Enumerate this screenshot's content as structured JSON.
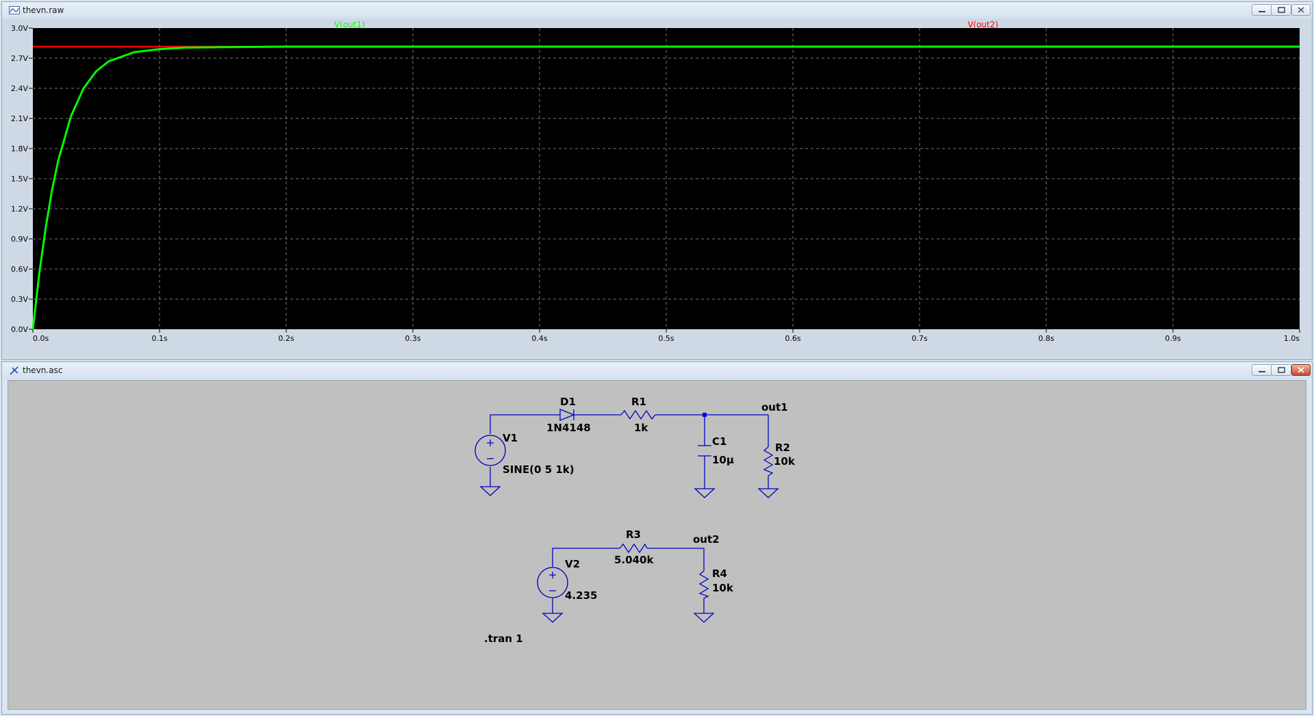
{
  "waveform_window": {
    "title": "thevn.raw",
    "traces": [
      {
        "name": "V(out1)",
        "color": "#00ff00"
      },
      {
        "name": "V(out2)",
        "color": "#ff0000"
      }
    ]
  },
  "schematic_window": {
    "title": "thevn.asc",
    "components": {
      "D1": {
        "ref": "D1",
        "value": "1N4148"
      },
      "R1": {
        "ref": "R1",
        "value": "1k"
      },
      "C1": {
        "ref": "C1",
        "value": "10µ"
      },
      "R2": {
        "ref": "R2",
        "value": "10k"
      },
      "V1": {
        "ref": "V1",
        "value": "SINE(0 5 1k)"
      },
      "R3": {
        "ref": "R3",
        "value": "5.040k"
      },
      "R4": {
        "ref": "R4",
        "value": "10k"
      },
      "V2": {
        "ref": "V2",
        "value": "4.235"
      }
    },
    "net_labels": {
      "out1": "out1",
      "out2": "out2"
    },
    "directive": ".tran 1"
  },
  "chart_data": {
    "type": "line",
    "xlabel": "",
    "ylabel": "",
    "xlim": [
      0,
      1.0
    ],
    "ylim": [
      0,
      3.0
    ],
    "x_tick_labels": [
      "0.0s",
      "0.1s",
      "0.2s",
      "0.3s",
      "0.4s",
      "0.5s",
      "0.6s",
      "0.7s",
      "0.8s",
      "0.9s",
      "1.0s"
    ],
    "y_tick_labels": [
      "0.0V",
      "0.3V",
      "0.6V",
      "0.9V",
      "1.2V",
      "1.5V",
      "1.8V",
      "2.1V",
      "2.4V",
      "2.7V",
      "3.0V"
    ],
    "grid": true,
    "series": [
      {
        "name": "V(out1)",
        "color": "#00ff00",
        "x": [
          0,
          0.005,
          0.01,
          0.015,
          0.02,
          0.03,
          0.04,
          0.05,
          0.06,
          0.08,
          0.1,
          0.12,
          0.15,
          0.2,
          0.3,
          0.4,
          0.5,
          0.6,
          0.7,
          0.8,
          0.9,
          1.0
        ],
        "y": [
          0,
          0.55,
          1.0,
          1.38,
          1.68,
          2.12,
          2.4,
          2.57,
          2.67,
          2.76,
          2.79,
          2.805,
          2.81,
          2.815,
          2.815,
          2.815,
          2.815,
          2.815,
          2.815,
          2.815,
          2.815,
          2.815
        ]
      },
      {
        "name": "V(out2)",
        "color": "#ff0000",
        "x": [
          0,
          1.0
        ],
        "y": [
          2.815,
          2.815
        ]
      }
    ]
  }
}
